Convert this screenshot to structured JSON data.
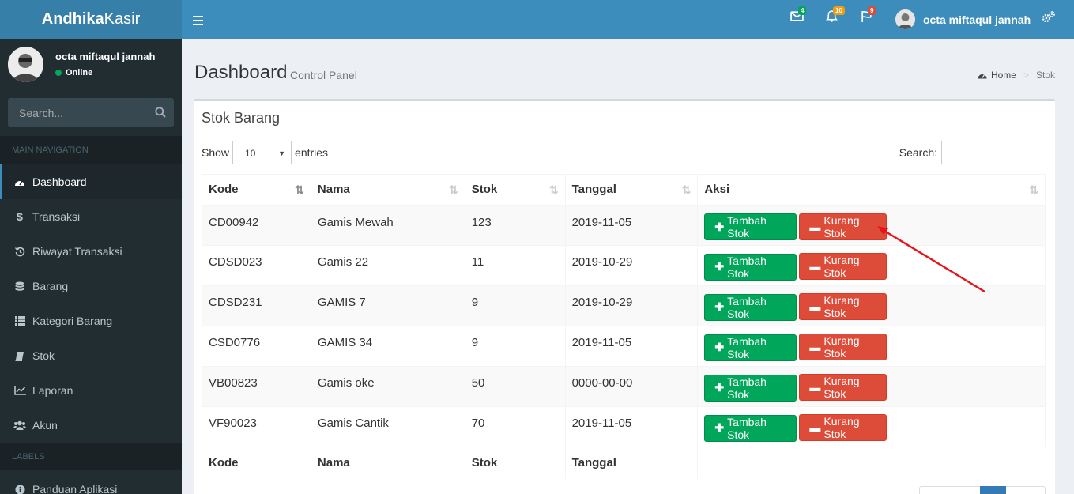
{
  "app": {
    "brand_bold": "Andhika",
    "brand_light": "Kasir"
  },
  "header": {
    "mail_badge": "4",
    "bell_badge": "10",
    "flag_badge": "9",
    "user_name": "octa miftaqul jannah"
  },
  "sidebar": {
    "user_name": "octa miftaqul jannah",
    "status": "Online",
    "search_placeholder": "Search...",
    "main_nav_header": "MAIN NAVIGATION",
    "labels_header": "LABELS",
    "items": [
      {
        "label": "Dashboard",
        "icon": "dashboard-icon"
      },
      {
        "label": "Transaksi",
        "icon": "dollar-icon"
      },
      {
        "label": "Riwayat Transaksi",
        "icon": "history-icon"
      },
      {
        "label": "Barang",
        "icon": "database-icon"
      },
      {
        "label": "Kategori Barang",
        "icon": "list-icon"
      },
      {
        "label": "Stok",
        "icon": "book-icon"
      },
      {
        "label": "Laporan",
        "icon": "line-chart-icon"
      },
      {
        "label": "Akun",
        "icon": "users-icon"
      }
    ],
    "label_items": [
      {
        "label": "Panduan Aplikasi",
        "icon": "info-icon"
      }
    ]
  },
  "page": {
    "title": "Dashboard",
    "subtitle": "Control Panel",
    "breadcrumb_home": "Home",
    "breadcrumb_current": "Stok"
  },
  "box": {
    "title": "Stok Barang",
    "show_label": "Show",
    "entries_value": "10",
    "entries_label": "entries",
    "search_label": "Search:",
    "columns": [
      "Kode",
      "Nama",
      "Stok",
      "Tanggal",
      "Aksi"
    ],
    "add_label": "Tambah Stok",
    "sub_label": "Kurang Stok",
    "rows": [
      {
        "kode": "CD00942",
        "nama": "Gamis Mewah",
        "stok": "123",
        "tanggal": "2019-11-05"
      },
      {
        "kode": "CDSD023",
        "nama": "Gamis 22",
        "stok": "11",
        "tanggal": "2019-10-29"
      },
      {
        "kode": "CDSD231",
        "nama": "GAMIS 7",
        "stok": "9",
        "tanggal": "2019-10-29"
      },
      {
        "kode": "CSD0776",
        "nama": "GAMIS 34",
        "stok": "9",
        "tanggal": "2019-11-05"
      },
      {
        "kode": "VB00823",
        "nama": "Gamis oke",
        "stok": "50",
        "tanggal": "0000-00-00"
      },
      {
        "kode": "VF90023",
        "nama": "Gamis Cantik",
        "stok": "70",
        "tanggal": "2019-11-05"
      }
    ],
    "footer_columns": [
      "Kode",
      "Nama",
      "Stok",
      "Tanggal"
    ]
  }
}
